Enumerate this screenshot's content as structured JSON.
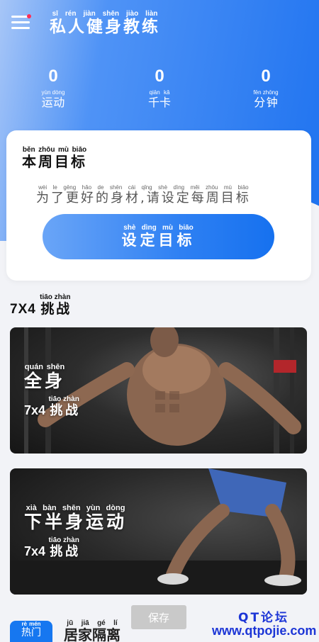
{
  "header": {
    "title": "私人健身教练",
    "title_pinyin": "sī rén jiàn shēn jiào liàn"
  },
  "stats": [
    {
      "value": "0",
      "label": "运动",
      "pinyin": "yùn dòng"
    },
    {
      "value": "0",
      "label": "千卡",
      "pinyin": "qiān kǎ"
    },
    {
      "value": "0",
      "label": "分钟",
      "pinyin": "fēn zhōng"
    }
  ],
  "goal": {
    "title": "本周目标",
    "title_pinyin": "běn zhōu mù biāo",
    "description": "为了更好的身材,请设定每周目标",
    "description_pinyin": "wèi le gēng hǎo de shēn cái qǐng shè dìng měi zhōu mù biāo",
    "button_label": "设定目标",
    "button_pinyin": "shè dìng mù biāo"
  },
  "section": {
    "prefix": "7X4",
    "title": "挑战",
    "title_pinyin": "tiāo zhàn"
  },
  "challenges": [
    {
      "name": "全身",
      "name_pinyin": "quán shēn",
      "sub_prefix": "7x4",
      "sub": "挑战",
      "sub_pinyin": "tiāo zhàn"
    },
    {
      "name": "下半身运动",
      "name_pinyin": "xià bàn shēn yùn dòng",
      "sub_prefix": "7x4",
      "sub": "挑战",
      "sub_pinyin": "tiāo zhàn"
    }
  ],
  "bottom": {
    "chip_label": "热门",
    "chip_pinyin": "rè mén",
    "heading": "居家隔离",
    "heading_pinyin": "jū jiā gé lí"
  },
  "save_label": "保存",
  "watermark": {
    "top": "QT论坛",
    "bottom": "www.qtpojie.com"
  },
  "colors": {
    "accent": "#1671ef",
    "header_start": "#a7c6f7",
    "watermark": "#1c35d6",
    "notification_dot": "#ff2d55"
  }
}
